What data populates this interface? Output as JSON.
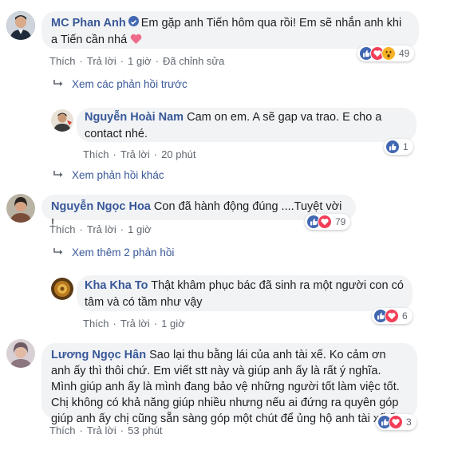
{
  "comments": [
    {
      "author": "MC Phan Anh",
      "text": "Em gặp anh Tiến hôm qua rồi! Em sẽ nhắn anh khi a Tiến cần nhá",
      "actions": {
        "like": "Thích",
        "reply": "Trả lời",
        "time": "1 giờ",
        "edited": "Đã chỉnh sửa"
      },
      "reactions": {
        "types": [
          "like-icon",
          "love-icon",
          "wow-icon"
        ],
        "count": "49"
      },
      "more_link": "Xem các phản hồi trước",
      "reply": {
        "author": "Nguyễn Hoài Nam",
        "text": "Cam on em. A sẽ gap va trao. E cho a contact nhé.",
        "actions": {
          "like": "Thích",
          "reply": "Trả lời",
          "time": "20 phút"
        },
        "reactions": {
          "types": [
            "like-icon"
          ],
          "count": "1"
        }
      },
      "more_link_2": "Xem phản hồi khác"
    },
    {
      "author": "Nguyễn Ngọc Hoa",
      "text": "Con đã hành động đúng ....Tuyệt vời !",
      "actions": {
        "like": "Thích",
        "reply": "Trả lời",
        "time": "1 giờ"
      },
      "reactions": {
        "types": [
          "like-icon",
          "love-icon"
        ],
        "count": "79"
      },
      "more_link": "Xem thêm 2 phản hồi",
      "reply": {
        "author": "Kha Kha To",
        "text": "Thật khâm phục bác đã sinh ra một người con có tâm và có tầm như vậy",
        "actions": {
          "like": "Thích",
          "reply": "Trả lời",
          "time": "1 giờ"
        },
        "reactions": {
          "types": [
            "like-icon",
            "love-icon"
          ],
          "count": "6"
        }
      }
    },
    {
      "author": "Lương Ngọc Hân",
      "text": "Sao lại thu bằng lái của anh tài xế. Ko cảm ơn anh ấy thì thôi chứ. Em viết stt này và giúp anh ấy là rất ý nghĩa. Mình giúp anh ấy là mình đang bảo vệ những người tốt làm việc tốt. Chị không có khả năng giúp nhiều nhưng nếu ai đứng ra quyên góp giúp anh ấy chị cũng sẵn sàng góp một chút để ủng hộ anh tài xế ấy.",
      "actions": {
        "like": "Thích",
        "reply": "Trả lời",
        "time": "53 phút"
      },
      "reactions": {
        "types": [
          "like-icon",
          "love-icon"
        ],
        "count": "3"
      }
    }
  ],
  "colors": {
    "link": "#385898",
    "bubble": "#f2f3f5",
    "meta": "#606770",
    "like": "#4267b2",
    "love": "#f33e58",
    "wow": "#f7b125"
  }
}
